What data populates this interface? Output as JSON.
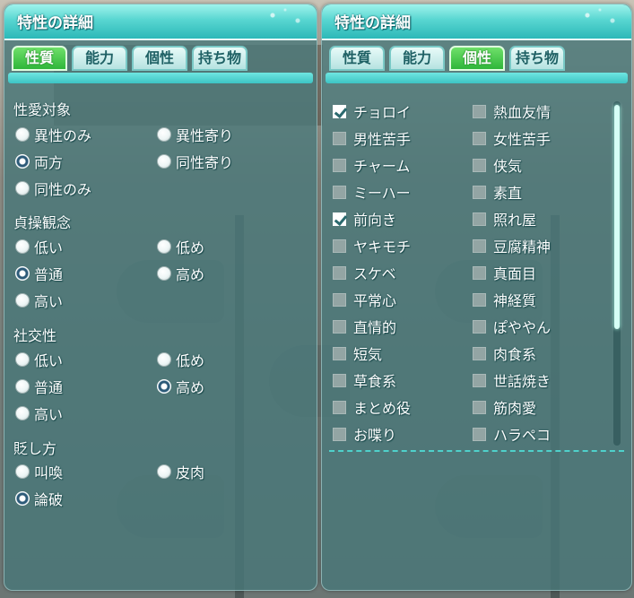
{
  "left_panel": {
    "title": "特性の詳細",
    "tabs": [
      {
        "label": "性質",
        "active": true
      },
      {
        "label": "能力",
        "active": false
      },
      {
        "label": "個性",
        "active": false
      },
      {
        "label": "持ち物",
        "active": false
      }
    ],
    "sections": [
      {
        "heading": "性愛対象",
        "options": [
          {
            "label": "異性のみ",
            "selected": false
          },
          {
            "label": "異性寄り",
            "selected": false
          },
          {
            "label": "両方",
            "selected": true
          },
          {
            "label": "同性寄り",
            "selected": false
          },
          {
            "label": "同性のみ",
            "selected": false
          }
        ]
      },
      {
        "heading": "貞操観念",
        "options": [
          {
            "label": "低い",
            "selected": false
          },
          {
            "label": "低め",
            "selected": false
          },
          {
            "label": "普通",
            "selected": true
          },
          {
            "label": "高め",
            "selected": false
          },
          {
            "label": "高い",
            "selected": false
          }
        ]
      },
      {
        "heading": "社交性",
        "options": [
          {
            "label": "低い",
            "selected": false
          },
          {
            "label": "低め",
            "selected": false
          },
          {
            "label": "普通",
            "selected": false
          },
          {
            "label": "高め",
            "selected": true
          },
          {
            "label": "高い",
            "selected": false
          }
        ]
      },
      {
        "heading": "貶し方",
        "options": [
          {
            "label": "叫喚",
            "selected": false
          },
          {
            "label": "皮肉",
            "selected": false
          },
          {
            "label": "論破",
            "selected": true
          }
        ]
      }
    ]
  },
  "right_panel": {
    "title": "特性の詳細",
    "tabs": [
      {
        "label": "性質",
        "active": false
      },
      {
        "label": "能力",
        "active": false
      },
      {
        "label": "個性",
        "active": true
      },
      {
        "label": "持ち物",
        "active": false
      }
    ],
    "traits_left": [
      {
        "label": "チョロイ",
        "checked": true
      },
      {
        "label": "男性苦手",
        "checked": false
      },
      {
        "label": "チャーム",
        "checked": false
      },
      {
        "label": "ミーハー",
        "checked": false
      },
      {
        "label": "前向き",
        "checked": true
      },
      {
        "label": "ヤキモチ",
        "checked": false
      },
      {
        "label": "スケベ",
        "checked": false
      },
      {
        "label": "平常心",
        "checked": false
      },
      {
        "label": "直情的",
        "checked": false
      },
      {
        "label": "短気",
        "checked": false
      },
      {
        "label": "草食系",
        "checked": false
      },
      {
        "label": "まとめ役",
        "checked": false
      },
      {
        "label": "お喋り",
        "checked": false
      }
    ],
    "traits_right": [
      {
        "label": "熱血友情",
        "checked": false
      },
      {
        "label": "女性苦手",
        "checked": false
      },
      {
        "label": "侠気",
        "checked": false
      },
      {
        "label": "素直",
        "checked": false
      },
      {
        "label": "照れ屋",
        "checked": false
      },
      {
        "label": "豆腐精神",
        "checked": false
      },
      {
        "label": "真面目",
        "checked": false
      },
      {
        "label": "神経質",
        "checked": false
      },
      {
        "label": "ぽややん",
        "checked": false
      },
      {
        "label": "肉食系",
        "checked": false
      },
      {
        "label": "世話焼き",
        "checked": false
      },
      {
        "label": "筋肉愛",
        "checked": false
      },
      {
        "label": "ハラペコ",
        "checked": false
      }
    ],
    "scroll_position": 0
  }
}
